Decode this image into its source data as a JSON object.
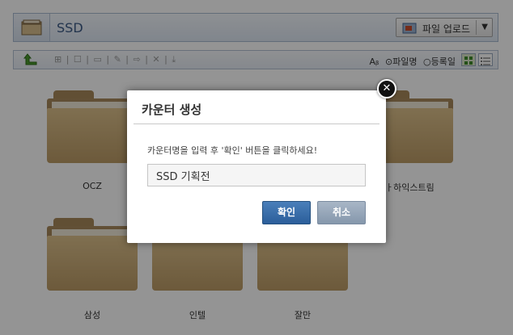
{
  "header": {
    "title": "SSD",
    "upload_label": "파일 업로드"
  },
  "toolbar": {
    "tools_glyphs": "⊞ | ☐ | ▭ | ✎ | ⇨ | ✕ | ⤓",
    "sort_prefix": "Aᵦ",
    "sort_name": "⊙파일명",
    "sort_date": "○등록일"
  },
  "folders": [
    {
      "label": "OCZ"
    },
    {
      "label": ""
    },
    {
      "label": ""
    },
    {
      "label": "ㅏ하익스트림"
    },
    {
      "label": "삼성"
    },
    {
      "label": "인텔"
    },
    {
      "label": "잘만"
    }
  ],
  "dialog": {
    "title": "카운터 생성",
    "message": "카운터명을 입력 후 '확인' 버튼을 클릭하세요!",
    "input_value": "SSD 기획전",
    "ok_label": "확인",
    "cancel_label": "취소",
    "close_glyph": "✕"
  }
}
